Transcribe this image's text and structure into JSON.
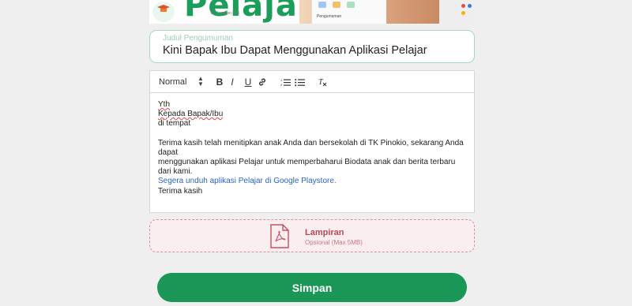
{
  "banner": {
    "brand": "Pelajar",
    "byline": "by Jaringan IDN",
    "screen_label": "Pengumuman"
  },
  "title_field": {
    "label": "Judul Pengumuman",
    "value": "Kini Bapak Ibu Dapat Menggunakan Aplikasi Pelajar"
  },
  "toolbar": {
    "format": "Normal",
    "bold": "B",
    "italic": "I",
    "underline": "U"
  },
  "content": {
    "line1": "Yth",
    "line2": "Kepada Bapak/Ibu",
    "line3": "di tempat",
    "para1_line1": "Terima kasih telah menitipkan anak Anda dan bersekolah di TK Pinokio, sekarang Anda dapat",
    "para1_line2": "menggunakan aplikasi Pelajar untuk memperbaharui Biodata anak dan berita terbaru dari kami.",
    "para1_line3": "Segera unduh aplikasi Pelajar di Google Playstore.",
    "closing": "Terima kasih"
  },
  "attachment": {
    "title": "Lampiran",
    "subtitle": "Opsional (Max 5MB)"
  },
  "save_button": "Simpan",
  "colors": {
    "primary": "#1a9756",
    "attach_accent": "#b94a55",
    "title_border": "#9fdcbd"
  }
}
